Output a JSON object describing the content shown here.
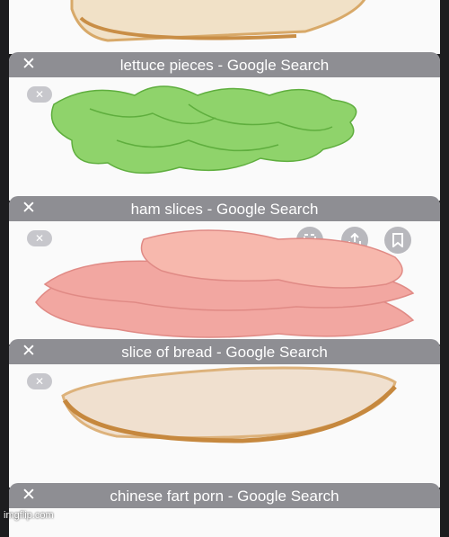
{
  "tabs": [
    {
      "title": ""
    },
    {
      "title": "lettuce pieces - Google Search"
    },
    {
      "title": "ham slices - Google Search"
    },
    {
      "title": "slice of bread - Google Search"
    },
    {
      "title": "chinese fart porn - Google Search"
    }
  ],
  "watermark": "imgflip.com",
  "colors": {
    "header": "#8e8e93",
    "card": "#f4f4f6",
    "background": "#1d1d1f"
  }
}
